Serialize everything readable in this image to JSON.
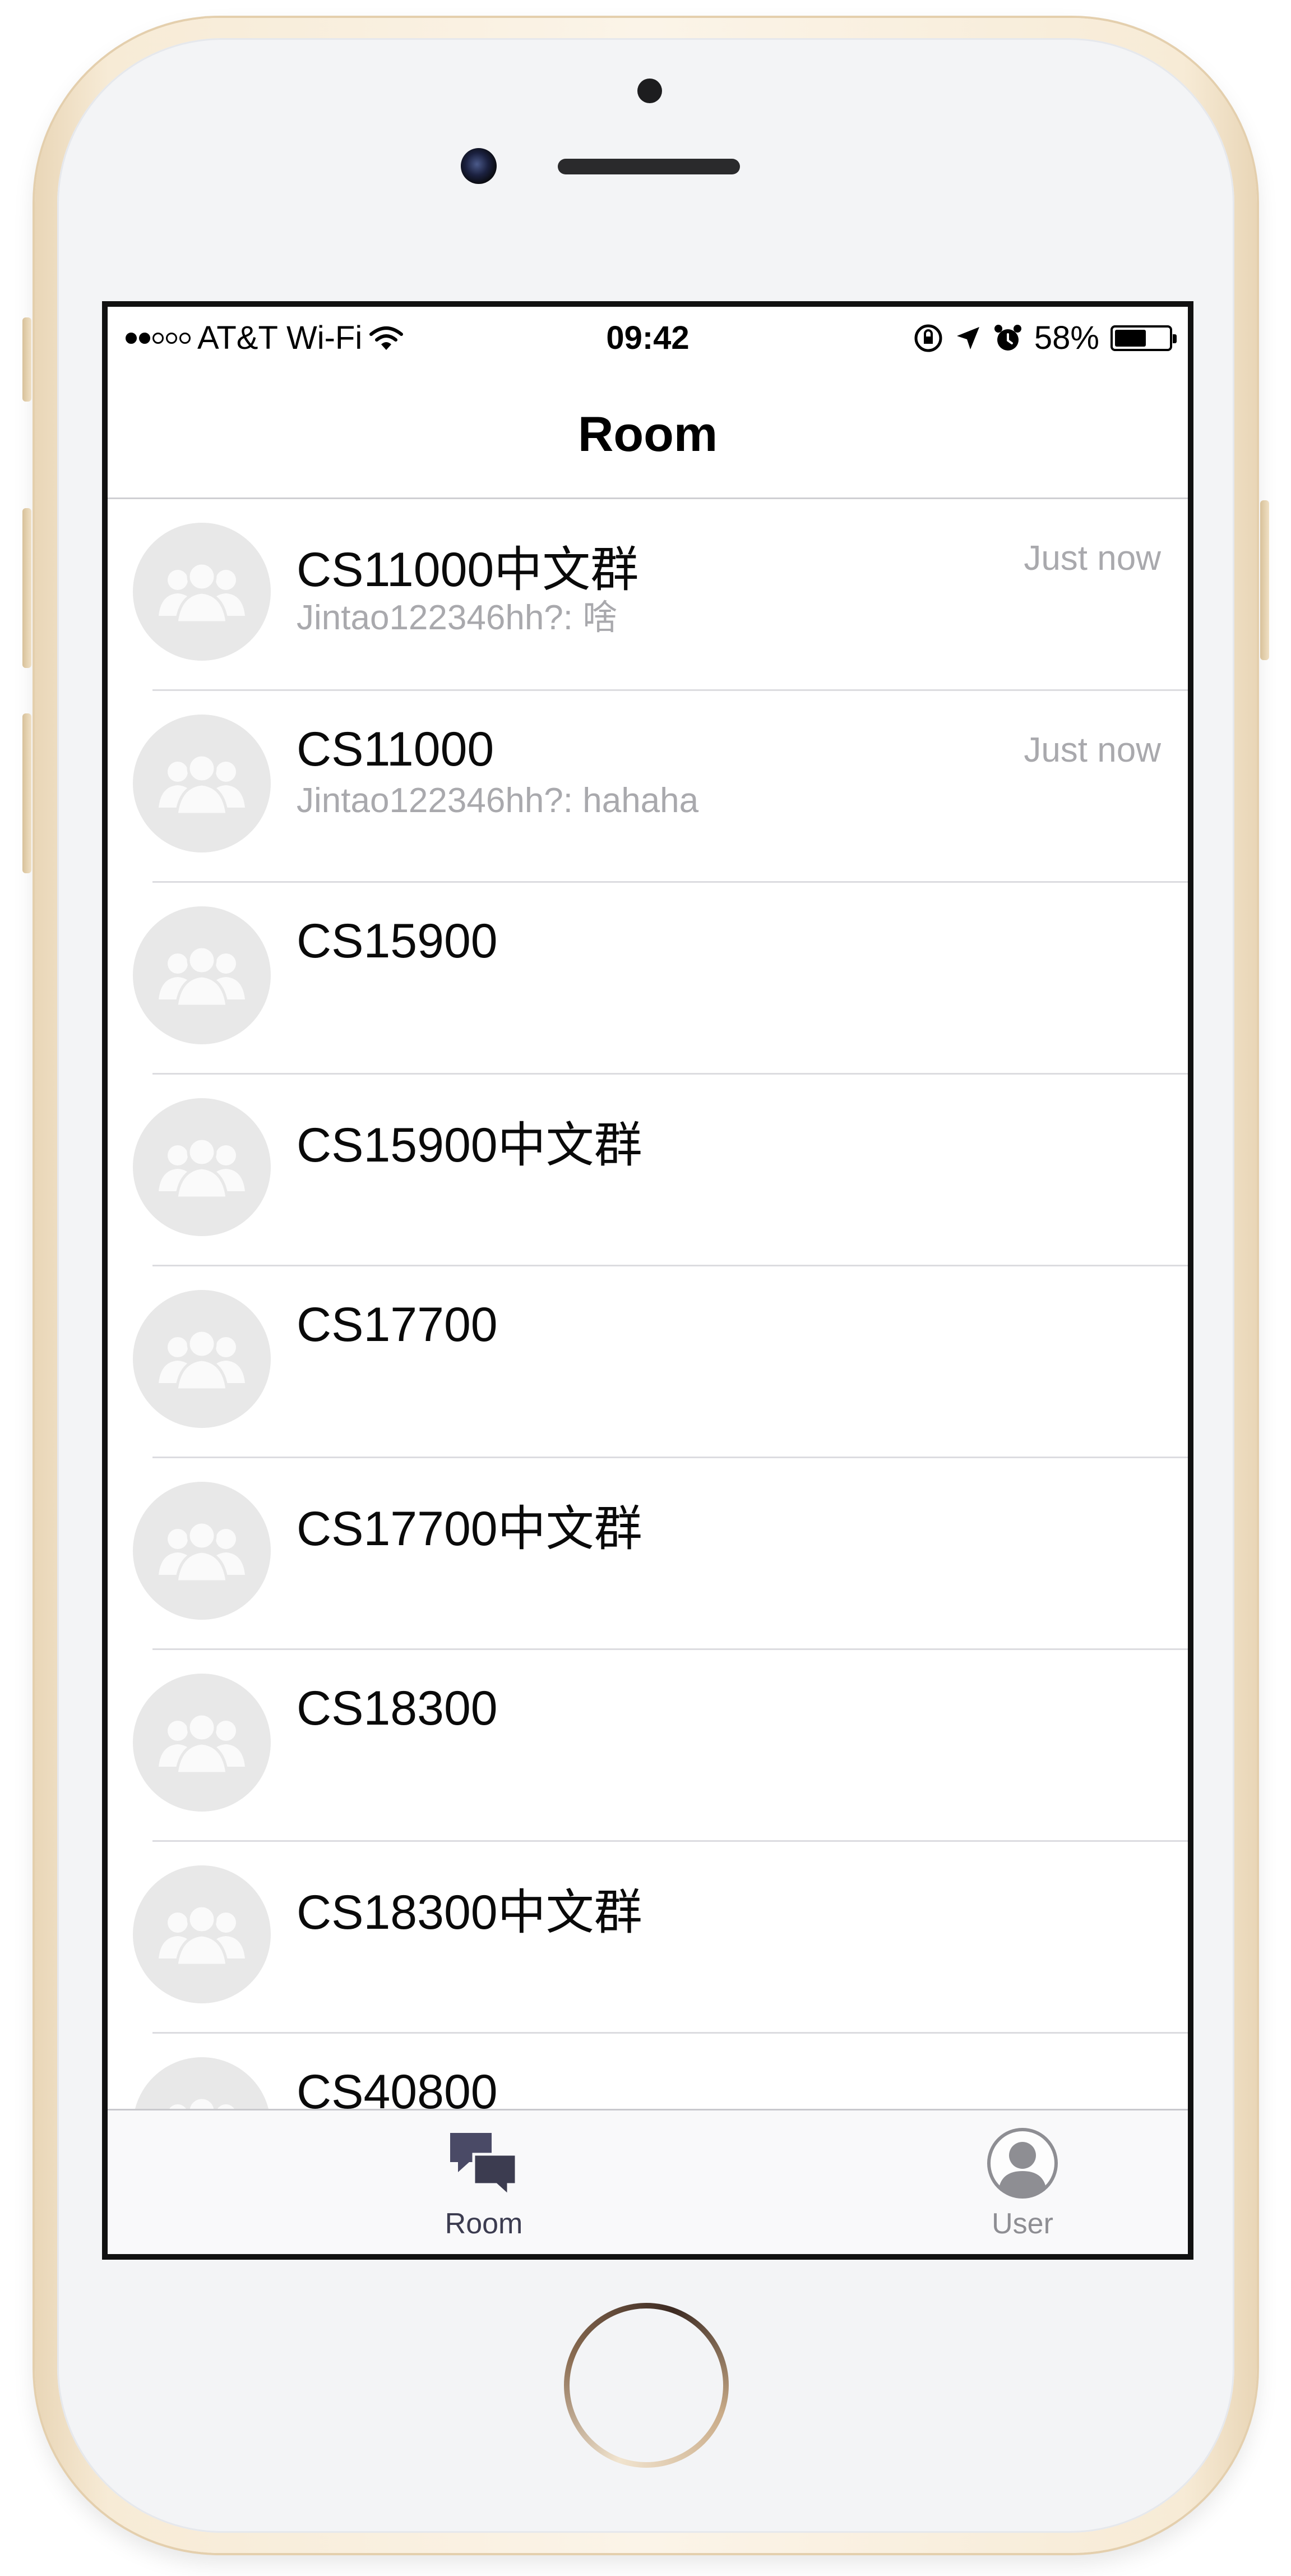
{
  "status_bar": {
    "carrier": "AT&T Wi-Fi",
    "time": "09:42",
    "battery": "58%",
    "battery_level": 0.58,
    "icons": [
      "signal-dots-icon",
      "wifi-icon",
      "orientation-lock-icon",
      "location-arrow-icon",
      "alarm-icon",
      "battery-icon"
    ]
  },
  "nav": {
    "title": "Room"
  },
  "rooms": [
    {
      "name": "CS11000中文群",
      "preview": "Jintao122346hh?: 啥",
      "time": "Just now"
    },
    {
      "name": "CS11000",
      "preview": "Jintao122346hh?: hahaha",
      "time": "Just now"
    },
    {
      "name": "CS15900",
      "preview": "",
      "time": ""
    },
    {
      "name": "CS15900中文群",
      "preview": "",
      "time": ""
    },
    {
      "name": "CS17700",
      "preview": "",
      "time": ""
    },
    {
      "name": "CS17700中文群",
      "preview": "",
      "time": ""
    },
    {
      "name": "CS18300",
      "preview": "",
      "time": ""
    },
    {
      "name": "CS18300中文群",
      "preview": "",
      "time": ""
    },
    {
      "name": "CS40800",
      "preview": "",
      "time": ""
    }
  ],
  "tabs": [
    {
      "label": "Room",
      "icon": "chat-bubbles-icon",
      "active": true
    },
    {
      "label": "User",
      "icon": "user-avatar-icon",
      "active": false
    }
  ],
  "colors": {
    "accent": "#3c3c50",
    "secondary_text": "#a9a9ad",
    "avatar_bg": "#e8e8e8",
    "inactive_tab": "#8e8e93"
  }
}
